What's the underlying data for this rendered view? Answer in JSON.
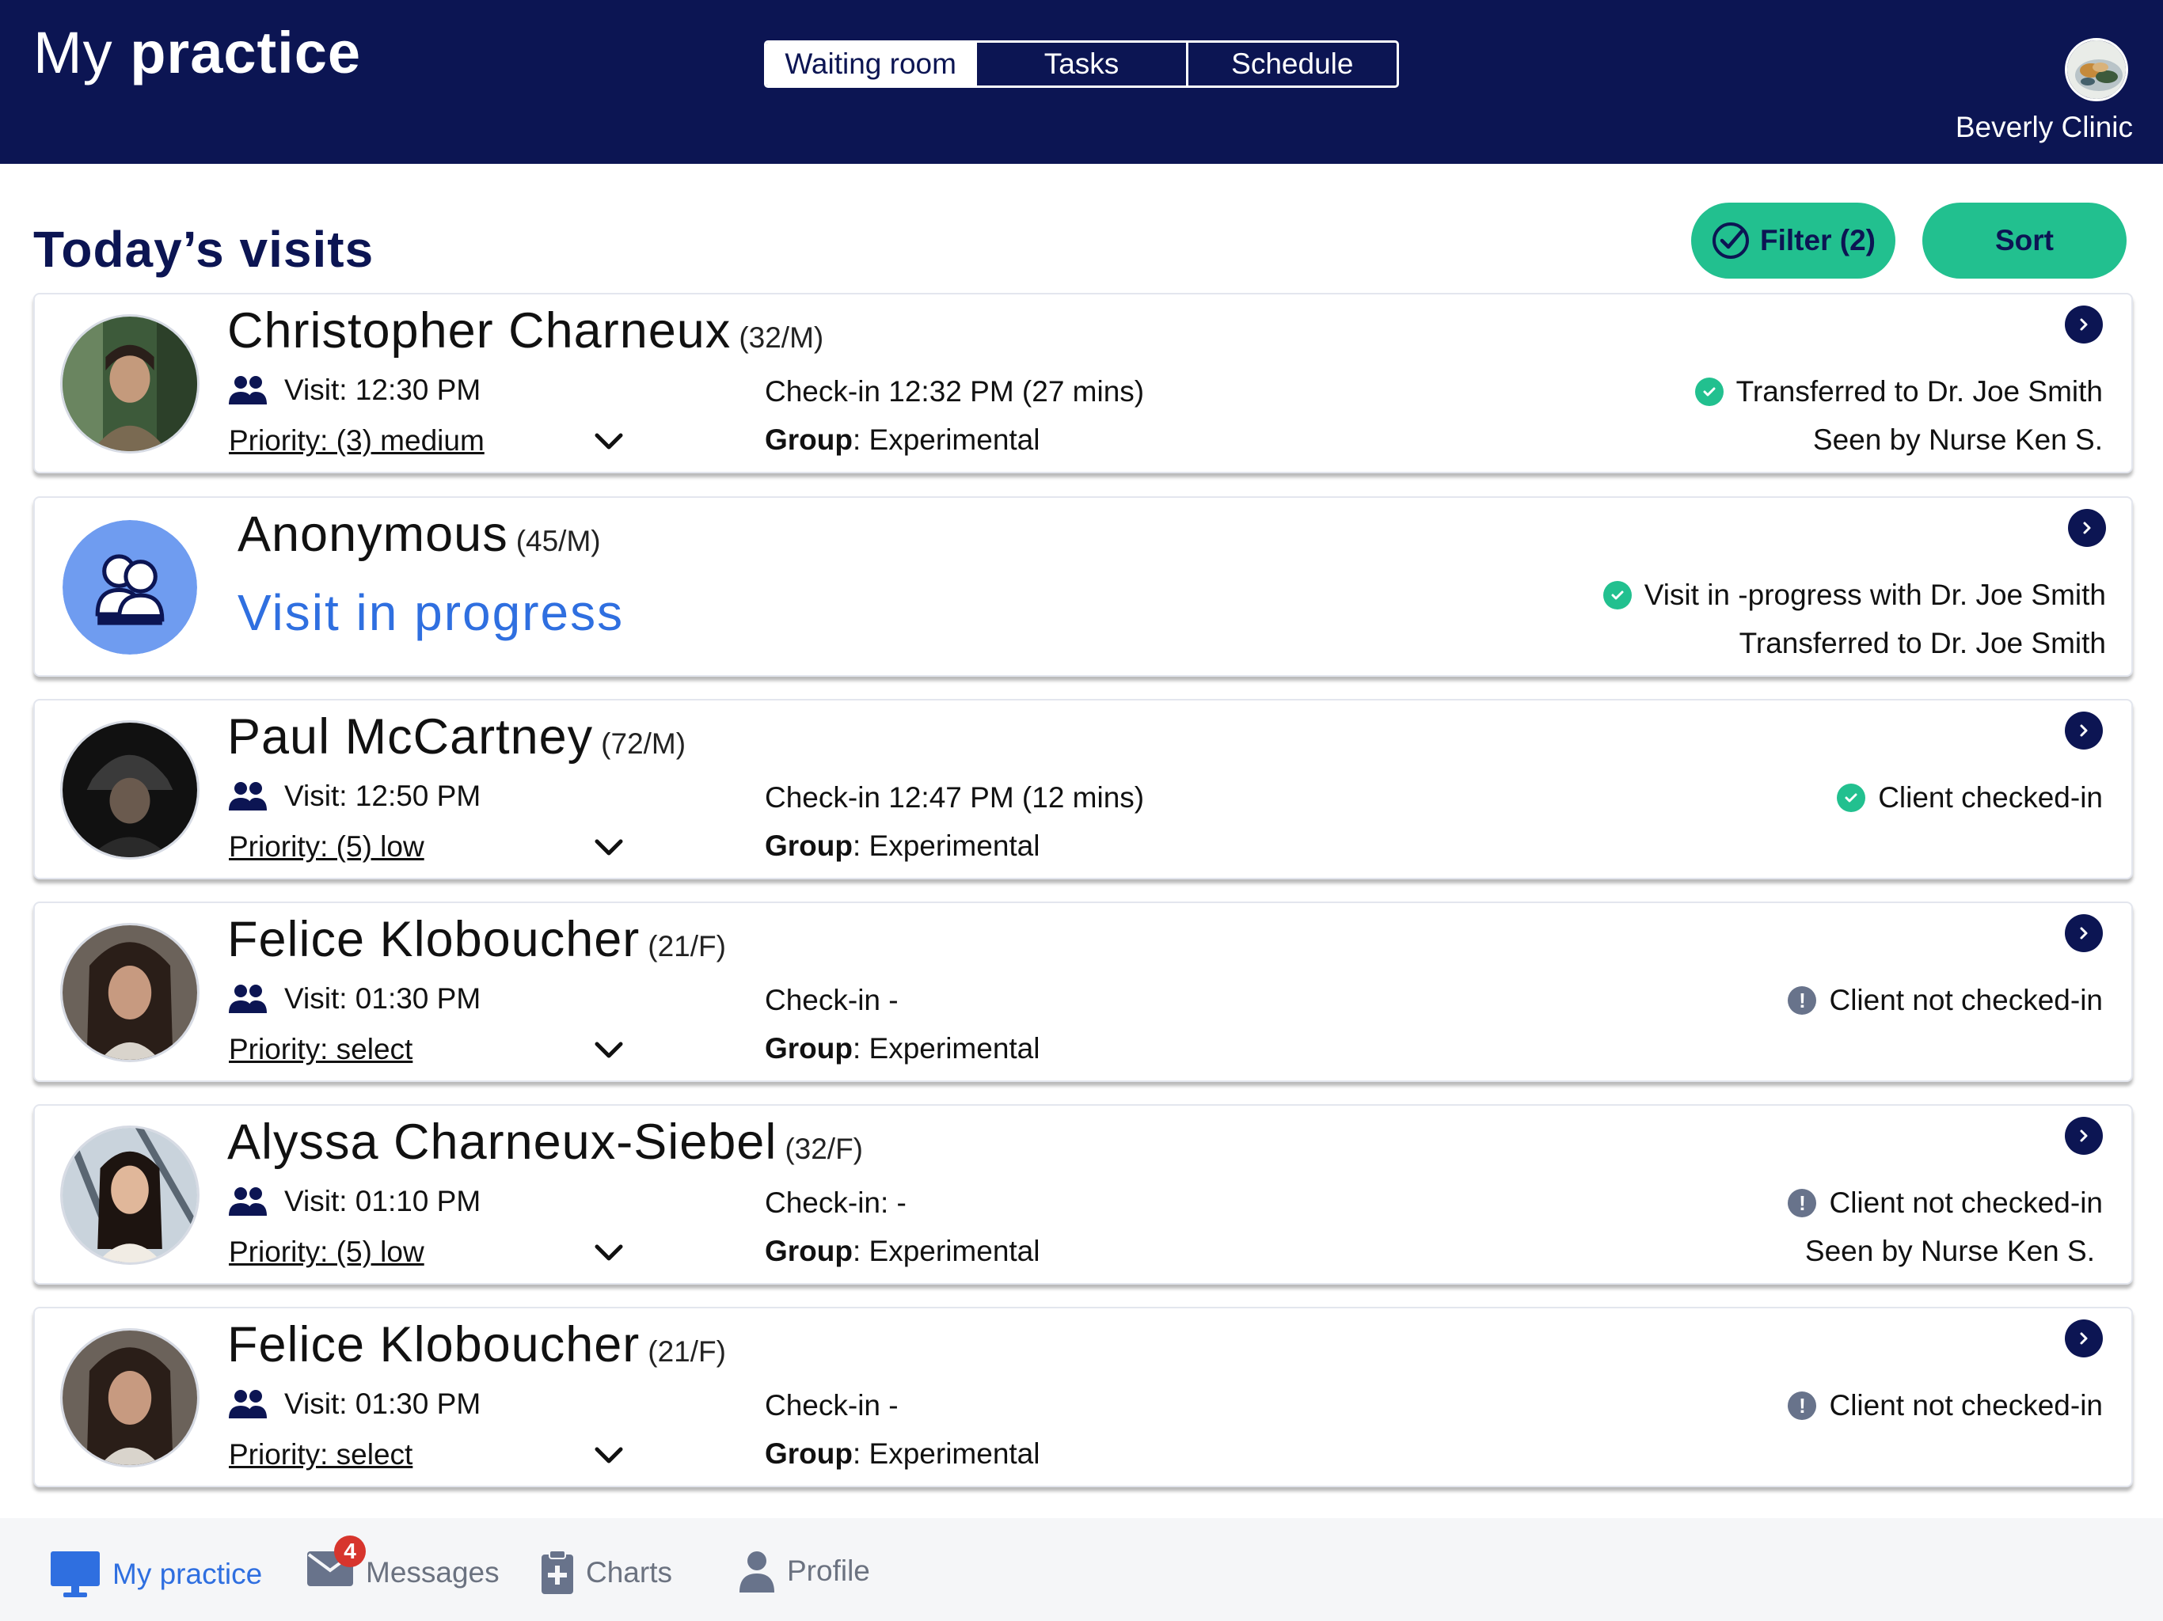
{
  "header": {
    "title_light": "My",
    "title_bold": "practice",
    "tabs": [
      {
        "label": "Waiting room",
        "active": true
      },
      {
        "label": "Tasks",
        "active": false
      },
      {
        "label": "Schedule",
        "active": false
      }
    ],
    "clinic_name": "Beverly Clinic"
  },
  "page": {
    "title": "Today’s visits",
    "filter_label": "Filter (2)",
    "sort_label": "Sort"
  },
  "visits": [
    {
      "name": "Christopher Charneux",
      "age": "(32/M)",
      "visit": "Visit: 12:30 PM",
      "priority": "Priority: (3) medium",
      "checkin": "Check-in 12:32 PM (27 mins)",
      "group_label": "Group",
      "group_value": ": Experimental",
      "status": "Transferred to Dr. Joe Smith",
      "status_kind": "ok",
      "status2": "Seen by Nurse Ken S."
    },
    {
      "name": "Anonymous",
      "age": "(45/M)",
      "progress": "Visit in progress",
      "status": "Visit in -progress with Dr. Joe Smith",
      "status_kind": "ok",
      "status2": "Transferred to Dr. Joe Smith"
    },
    {
      "name": "Paul McCartney",
      "age": "(72/M)",
      "visit": "Visit: 12:50 PM",
      "priority": "Priority: (5) low",
      "checkin": "Check-in 12:47 PM (12 mins)",
      "group_label": "Group",
      "group_value": ": Experimental",
      "status": "Client checked-in",
      "status_kind": "ok"
    },
    {
      "name": "Felice Kloboucher",
      "age": "(21/F)",
      "visit": "Visit: 01:30 PM",
      "priority": "Priority: select",
      "checkin": "Check-in -",
      "group_label": "Group",
      "group_value": ": Experimental",
      "status": "Client not checked-in",
      "status_kind": "warn"
    },
    {
      "name": "Alyssa Charneux-Siebel",
      "age": "(32/F)",
      "visit": "Visit: 01:10 PM",
      "priority": "Priority: (5) low",
      "checkin": "Check-in: -",
      "group_label": "Group",
      "group_value": ": Experimental",
      "status": "Client not checked-in",
      "status_kind": "warn",
      "status2": "Seen by Nurse Ken S."
    },
    {
      "name": "Felice Kloboucher",
      "age": "(21/F)",
      "visit": "Visit: 01:30 PM",
      "priority": "Priority: select",
      "checkin": "Check-in -",
      "group_label": "Group",
      "group_value": ": Experimental",
      "status": "Client not checked-in",
      "status_kind": "warn"
    }
  ],
  "nav": {
    "items": [
      {
        "label": "My practice",
        "icon": "monitor-icon",
        "active": true
      },
      {
        "label": "Messages",
        "icon": "mail-icon",
        "badge": "4"
      },
      {
        "label": "Charts",
        "icon": "clipboard-icon"
      },
      {
        "label": "Profile",
        "icon": "person-icon"
      }
    ]
  },
  "colors": {
    "navy": "#0c1553",
    "accent_green": "#22c08f",
    "link_blue": "#2f6fe0",
    "alert_red": "#d7352d"
  }
}
